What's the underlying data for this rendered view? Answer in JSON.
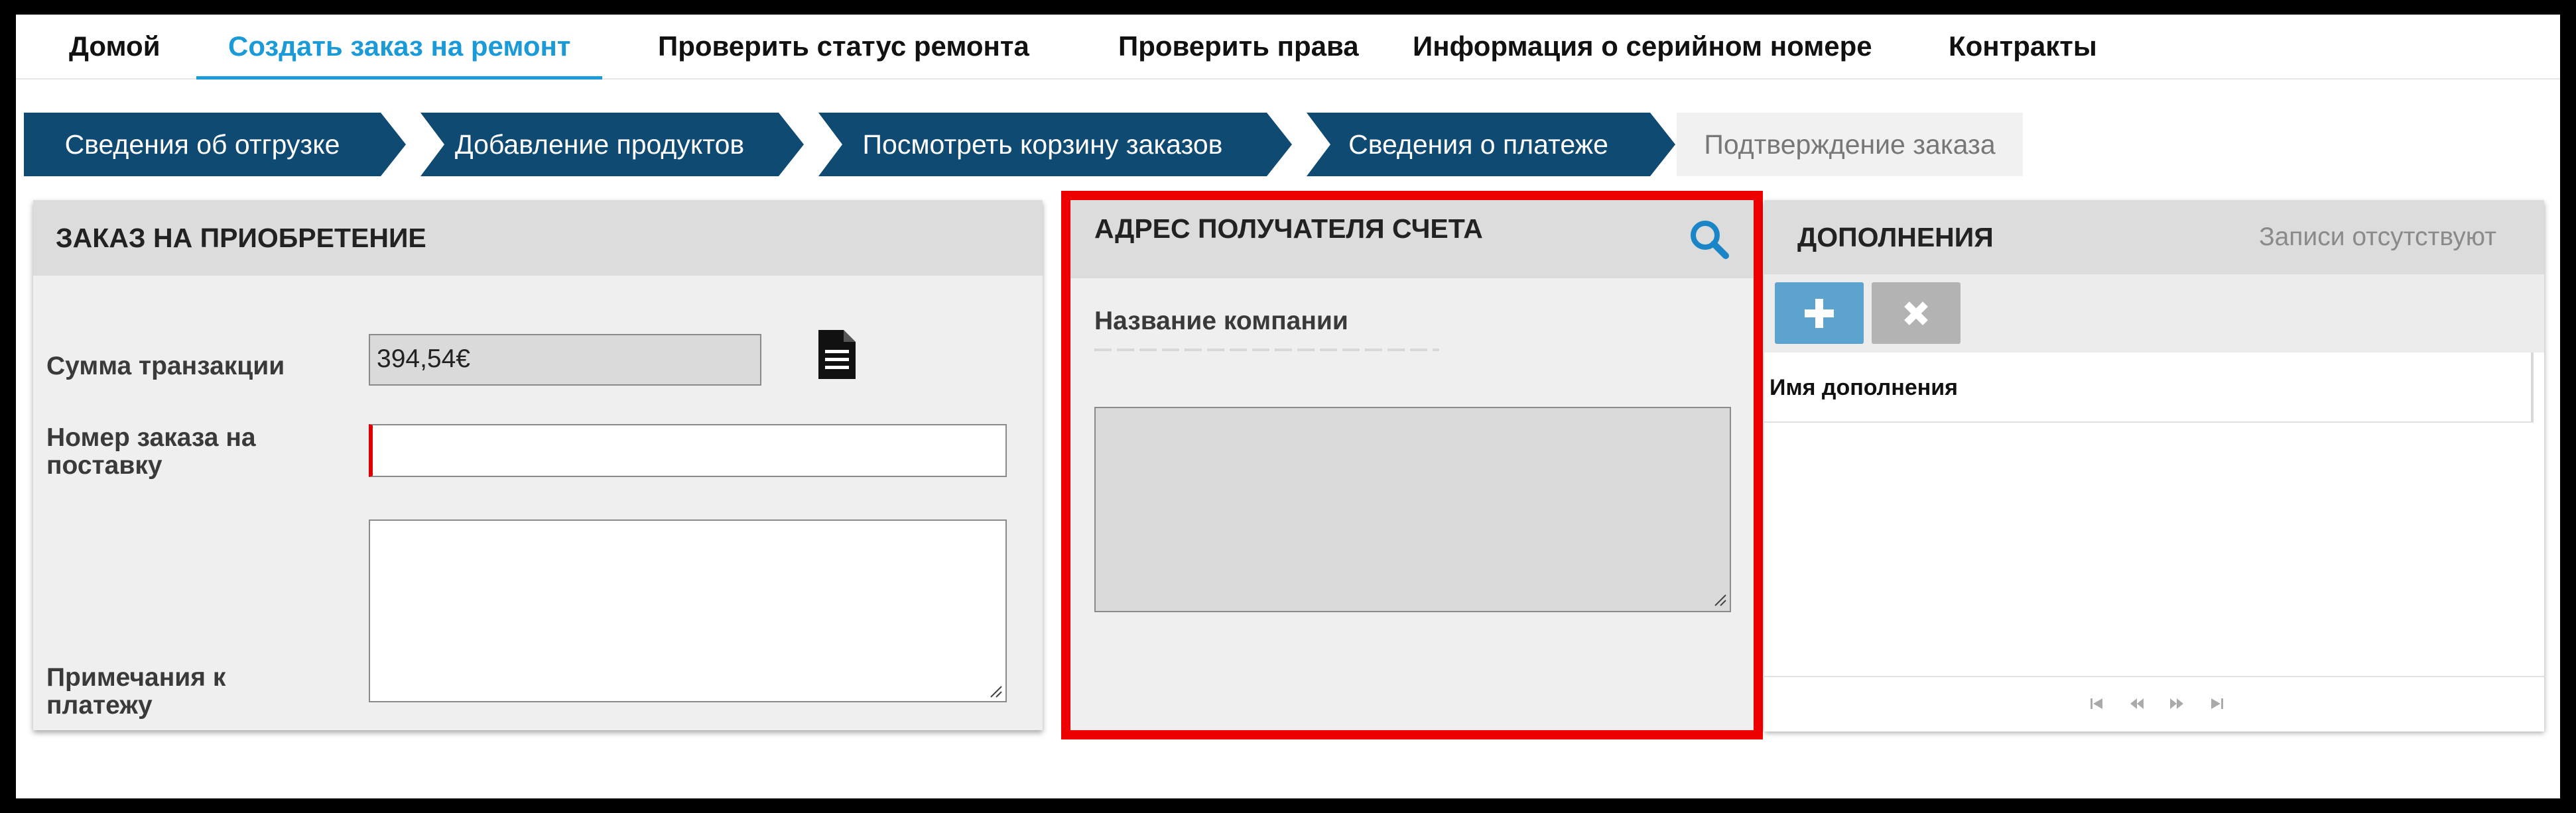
{
  "nav": {
    "items": [
      "Домой",
      "Создать заказ на ремонт",
      "Проверить статус ремонта",
      "Проверить права",
      "Информация о серийном номере",
      "Контракты"
    ],
    "active": "Создать заказ на ремонт"
  },
  "steps": [
    "Сведения об отгрузке",
    "Добавление продуктов",
    "Посмотреть корзину заказов",
    "Сведения о платеже",
    "Подтверждение заказа"
  ],
  "purchase": {
    "title": "ЗАКАЗ НА ПРИОБРЕТЕНИЕ",
    "amount_label": "Сумма транзакции",
    "amount_value": "394,54€",
    "order_number_label": "Номер заказа на поставку",
    "order_number_value": "",
    "notes_label": "Примечания к платежу",
    "notes_value": ""
  },
  "billing": {
    "title": "АДРЕС ПОЛУЧАТЕЛЯ СЧЕТА",
    "company_label": "Название компании",
    "address_value": ""
  },
  "addons": {
    "title": "ДОПОЛНЕНИЯ",
    "empty_text": "Записи отсутствуют",
    "column_header": "Имя дополнения"
  },
  "colors": {
    "accent": "#1a9ad6",
    "step_active": "#0f4a73",
    "highlight": "#ee0000",
    "add_button": "#5da3cf",
    "remove_button": "#b3b3b3"
  },
  "icons": {
    "document": "document-icon",
    "search": "search-icon",
    "add": "plus-icon",
    "remove": "close-icon",
    "pager": [
      "first-page-icon",
      "prev-page-icon",
      "next-page-icon",
      "last-page-icon"
    ]
  }
}
